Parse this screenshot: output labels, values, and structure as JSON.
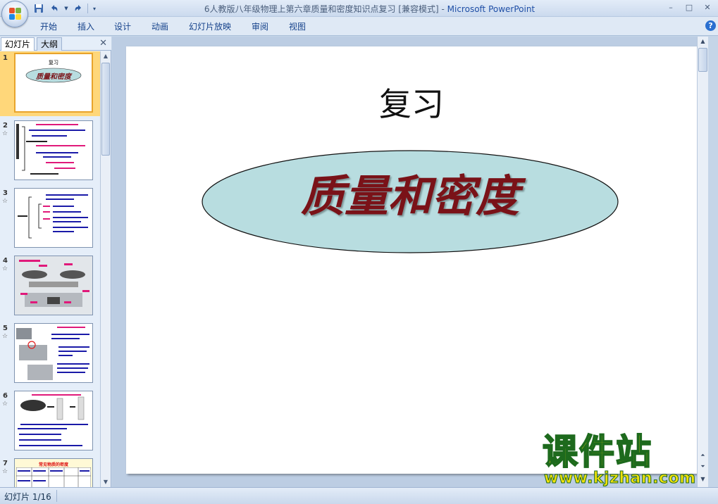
{
  "window": {
    "title": "6人教版八年级物理上第六章质量和密度知识点复习 [兼容模式] - ",
    "app_name": "Microsoft PowerPoint",
    "controls": [
      "–",
      "□",
      "✕"
    ]
  },
  "quick_access": {
    "save": "save-icon",
    "undo": "undo-icon",
    "redo": "redo-icon"
  },
  "ribbon": {
    "tabs": [
      "开始",
      "插入",
      "设计",
      "动画",
      "幻灯片放映",
      "审阅",
      "视图"
    ],
    "help": "?"
  },
  "left_panel": {
    "tabs": [
      "幻灯片",
      "大纲"
    ],
    "close": "✕",
    "thumbnails": [
      {
        "num": "1",
        "selected": true,
        "star": ""
      },
      {
        "num": "2",
        "selected": false,
        "star": "☆"
      },
      {
        "num": "3",
        "selected": false,
        "star": "☆"
      },
      {
        "num": "4",
        "selected": false,
        "star": "☆"
      },
      {
        "num": "5",
        "selected": false,
        "star": "☆"
      },
      {
        "num": "6",
        "selected": false,
        "star": "☆"
      },
      {
        "num": "7",
        "selected": false,
        "star": "☆"
      }
    ],
    "thumb1_title": "复习",
    "thumb1_main": "质量和密度",
    "thumb7_title": "常见物质的密度"
  },
  "slide": {
    "title": "复习",
    "main_text": "质量和密度",
    "ellipse_fill": "#b8dde0",
    "main_color": "#7a1218"
  },
  "watermark": {
    "big": "课件站",
    "small": "www.kjzhan.com"
  },
  "status": {
    "slide_info": "幻灯片 1/16"
  }
}
